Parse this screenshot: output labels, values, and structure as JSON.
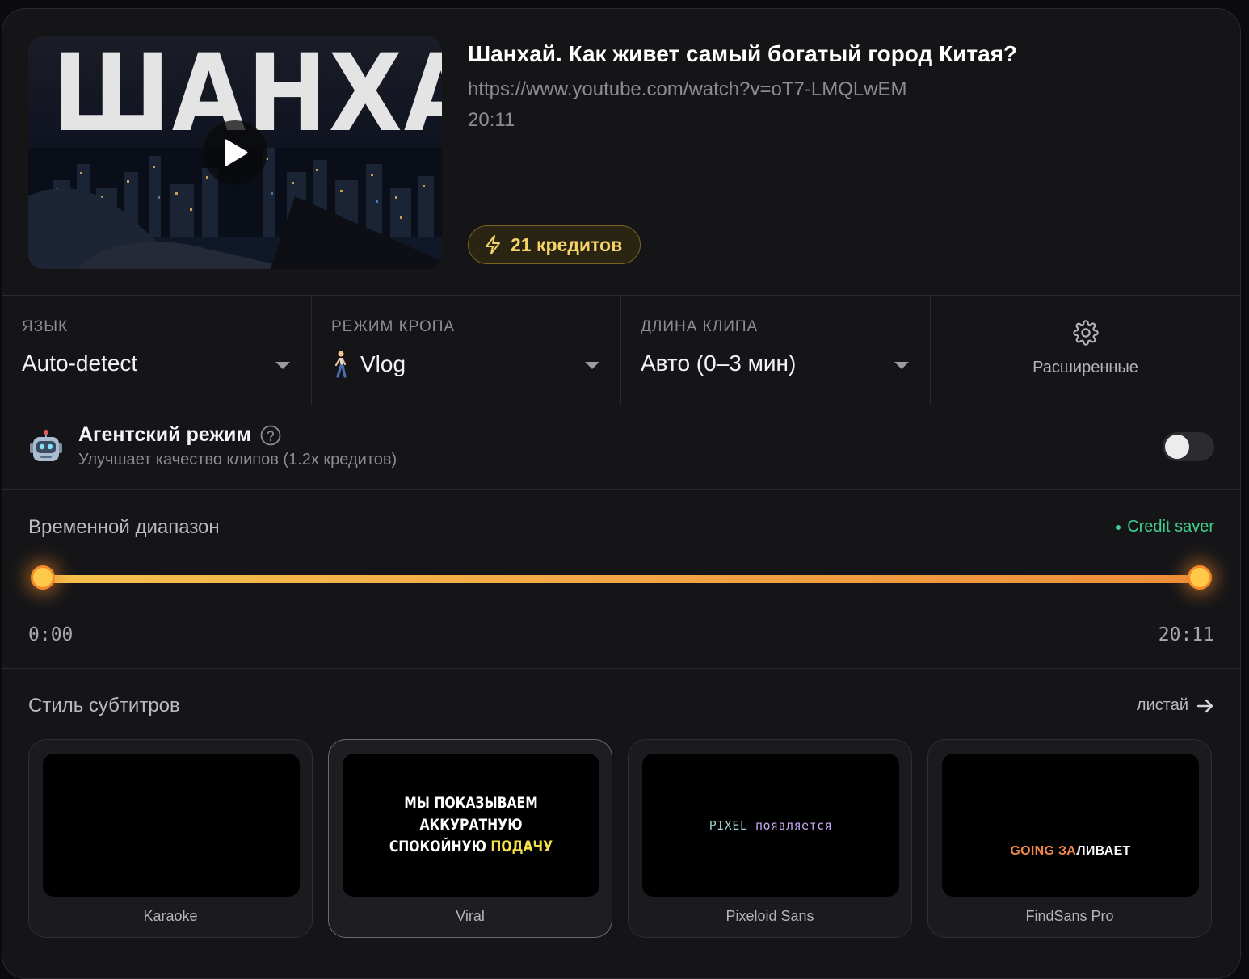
{
  "video": {
    "title": "Шанхай. Как живет самый богатый город Китая?",
    "url": "https://www.youtube.com/watch?v=oT7-LMQLwEM",
    "duration": "20:11",
    "thumbnail_text": "ШАНХАЙ",
    "credits": "21 кредитов"
  },
  "settings": {
    "language": {
      "label": "ЯЗЫК",
      "value": "Auto-detect"
    },
    "crop": {
      "label": "РЕЖИМ КРОПА",
      "value": "Vlog",
      "icon": "walking-person-icon"
    },
    "clip_length": {
      "label": "ДЛИНА КЛИПА",
      "value": "Авто (0–3 мин)"
    },
    "advanced": {
      "label": "Расширенные",
      "icon": "gear-icon"
    }
  },
  "agent": {
    "title": "Агентский режим",
    "description": "Улучшает качество клипов (1.2x кредитов)",
    "enabled": false,
    "icon": "robot-icon"
  },
  "time_range": {
    "title": "Временной диапазон",
    "credit_saver": "Credit saver",
    "start": "0:00",
    "end": "20:11",
    "start_fraction": 0,
    "end_fraction": 1
  },
  "subtitles": {
    "title": "Стиль субтитров",
    "browse_label": "листай",
    "styles": [
      {
        "name": "Karaoke",
        "preview": ""
      },
      {
        "name": "Viral",
        "preview_line1": "МЫ ПОКАЗЫВАЕМ АККУРАТНУЮ",
        "preview_line2": "СПОКОЙНУЮ",
        "preview_highlight": "ПОДАЧУ",
        "selected": true
      },
      {
        "name": "Pixeloid Sans",
        "preview_a": "PIXEL",
        "preview_b": "появляется"
      },
      {
        "name": "FindSans Pro",
        "preview_a": "GOING",
        "preview_b_colored": "ЗА",
        "preview_b": "ЛИВАЕТ"
      }
    ]
  },
  "colors": {
    "accent": "#f2a646",
    "credit_saver": "#3fcf8e",
    "badge_text": "#f6d36a"
  }
}
